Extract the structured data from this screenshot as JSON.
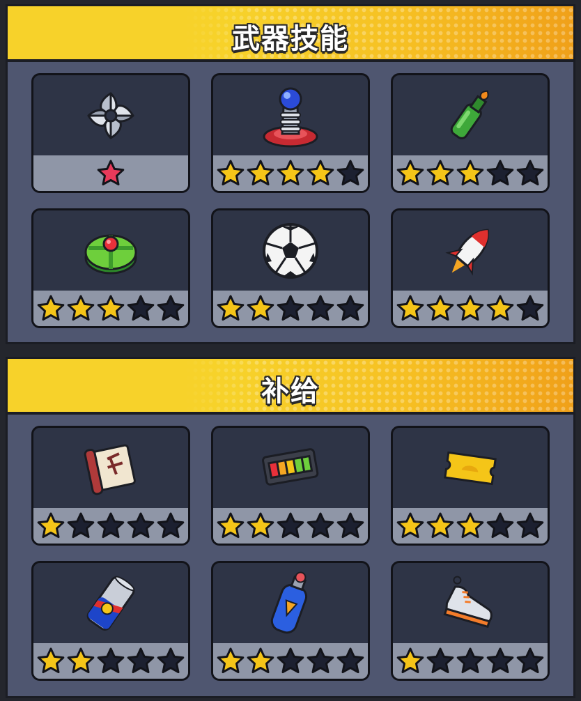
{
  "sections": [
    {
      "title": "武器技能",
      "items": [
        {
          "icon": "shuriken-icon",
          "stars": 1,
          "max": 1,
          "star_color": "#e83a5a"
        },
        {
          "icon": "tesla-coil-icon",
          "stars": 4,
          "max": 5
        },
        {
          "icon": "molotov-bottle-icon",
          "stars": 3,
          "max": 5
        },
        {
          "icon": "landmine-icon",
          "stars": 3,
          "max": 5
        },
        {
          "icon": "soccer-ball-icon",
          "stars": 2,
          "max": 5
        },
        {
          "icon": "rocket-icon",
          "stars": 4,
          "max": 5
        }
      ]
    },
    {
      "title": "补给",
      "items": [
        {
          "icon": "scroll-icon",
          "stars": 1,
          "max": 5
        },
        {
          "icon": "battery-pack-icon",
          "stars": 2,
          "max": 5
        },
        {
          "icon": "golden-ticket-icon",
          "stars": 3,
          "max": 5
        },
        {
          "icon": "energy-drink-can-icon",
          "stars": 2,
          "max": 5
        },
        {
          "icon": "oxygen-tank-icon",
          "stars": 2,
          "max": 5
        },
        {
          "icon": "sneaker-icon",
          "stars": 1,
          "max": 5
        }
      ]
    }
  ],
  "colors": {
    "star_filled": "#f5c518",
    "star_empty": "#1c2030",
    "banner": "#f6d12a",
    "panel": "#4f5670",
    "card": "#2e3446",
    "star_bar": "#8f96a7"
  }
}
